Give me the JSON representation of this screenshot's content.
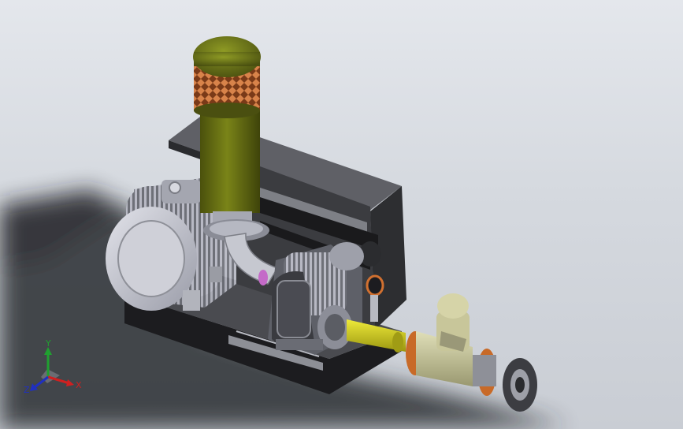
{
  "view": {
    "background_top": "#e4e7ec",
    "background_bottom": "#c9cdd4"
  },
  "model": {
    "filter_color": "#5c6410",
    "filter_mesh_color": "#c06a36",
    "frame_color": "#2f3033",
    "motor_color": "#c6c7d0",
    "pipe_color": "#d4d21a",
    "valve_color": "#c8c69a",
    "flange_accent_color": "#c86a28",
    "gauge_accent_color": "#d07030"
  },
  "triad": {
    "x_label": "X",
    "y_label": "Y",
    "z_label": "Z",
    "x_color": "#d02020",
    "y_color": "#20a030",
    "z_color": "#2030c0"
  }
}
